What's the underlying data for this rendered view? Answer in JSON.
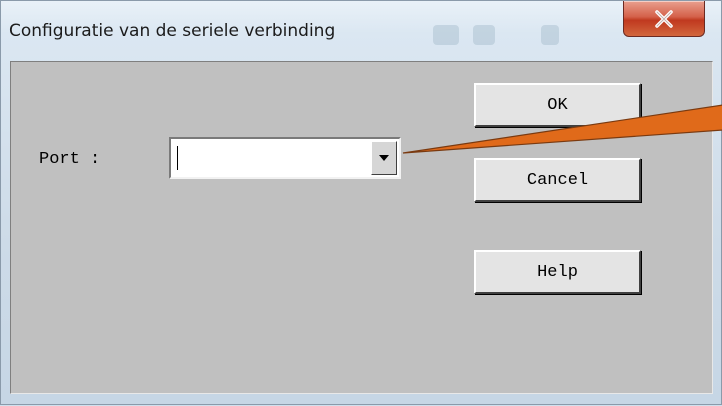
{
  "window": {
    "title": "Configuratie van de seriele verbinding",
    "close_glyph": "X"
  },
  "form": {
    "port_label": "Port :",
    "port_value": ""
  },
  "buttons": {
    "ok_label": "OK",
    "cancel_label": "Cancel",
    "help_label": "Help"
  },
  "colors": {
    "client_bg": "#c0c0c0",
    "close_button": "#c0391f",
    "annotation_arrow": "#e06a1a"
  },
  "icons": {
    "close": "close-icon",
    "dropdown": "chevron-down-icon",
    "annotation": "arrow-annotation"
  }
}
